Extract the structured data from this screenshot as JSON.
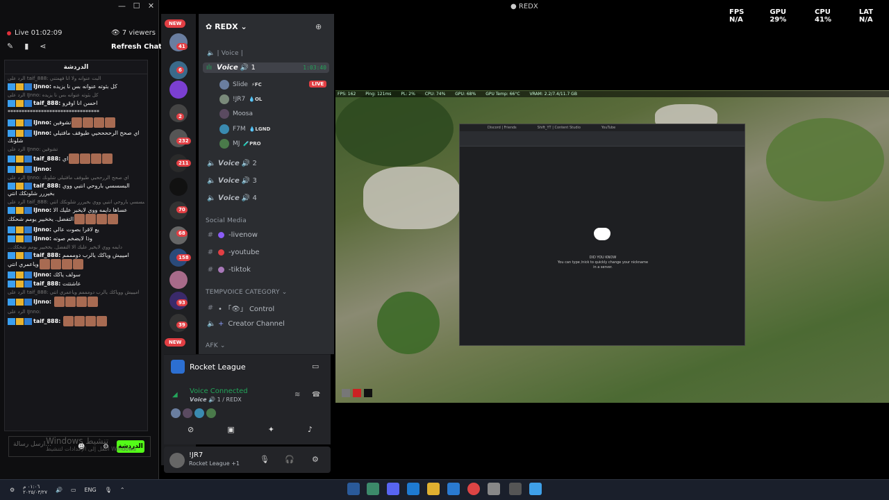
{
  "chat": {
    "live_time": "Live 01:02:09",
    "viewers": "7 viewers",
    "refresh": "Refresh Chat",
    "header": "الدردشة",
    "messages": [
      {
        "reply": "الرد على taif_888: البت عنوانه ولا انا فهمتني",
        "user": "IJnno:",
        "text": "كل بثوته عنوانه بس نا يزيده"
      },
      {
        "reply": "الرد على IJnno: كل بثوته عنوانه بس نا يزيده",
        "user": "taif_888:",
        "text": "احسن انا اوقرو"
      },
      {
        "reply": "",
        "user": "",
        "text": "*********************************"
      },
      {
        "reply": "",
        "user": "IJnno:",
        "text": "تشوفين"
      },
      {
        "reply": "",
        "user": "IJnno:",
        "text": "اي صحح الرححححيي طيوفف مافتيلي شلونك"
      },
      {
        "reply": "الرد على IJnno: تشوفين",
        "user": "taif_888:",
        "text": "اي"
      },
      {
        "reply": "",
        "user": "IJnno:",
        "text": ""
      },
      {
        "reply": "الرد على IJnno: اي صحح الررححيي طيوفف مافتيلي شلونك",
        "user": "taif_888:",
        "text": "البسسسي باروحي انتيي ووي بخيررر شلونكك انتي"
      },
      {
        "reply": "الرد على taif_888: البسسسي باروحي انتيي ووي بخيررر شلونكك انتي",
        "user": "IJnno:",
        "text": "عساها دايمه ووي لايخبر عليك الا التفضل. يخخيير يومم شحكك"
      },
      {
        "reply": "",
        "user": "IJnno:",
        "text": "يع لاقرا بصوت عالي"
      },
      {
        "reply": "",
        "user": "IJnno:",
        "text": "وذا لايضخم صوته"
      },
      {
        "reply": "...دايمه ووي لايخير عليك الا التفضل. يخخيير يومم شحكك",
        "user": "taif_888:",
        "text": "اميييش وياكك يالرب دومممم وياعمري انتي"
      },
      {
        "reply": "",
        "user": "IJnno:",
        "text": "سولف ياكك"
      },
      {
        "reply": "",
        "user": "taif_888:",
        "text": "عاشتتت"
      },
      {
        "reply": "الرد على taif_888: اميييش ووياكك يالرب دومممم وياعمري انتي",
        "user": "IJnno:",
        "text": ""
      },
      {
        "reply": "الرد على IJnno:",
        "user": "taif_888:",
        "text": ""
      }
    ],
    "input_placeholder": "ارسل رسالة...",
    "send": "الدردشة",
    "watermark1": "Windows تنشيط",
    "watermark2": "انتقل إلى الإعدادات لتنشيط Windows"
  },
  "discord": {
    "server_name": "REDX",
    "new_label": "NEW",
    "server_badges": [
      "41",
      "6",
      "2",
      "232",
      "211",
      "70",
      "68",
      "158",
      "93",
      "39"
    ],
    "categories": {
      "voices": "| Voice |",
      "social": "Social Media",
      "temp": "TEMPVOICE CATEGORY",
      "afk": "AFK"
    },
    "active_channel": "𝙑𝙤𝙞𝙘𝙚 🔊 1",
    "active_time": "1:03:40",
    "members": [
      {
        "name": "Slide",
        "tag": "⚡FC"
      },
      {
        "name": "!JR7",
        "tag": "💧OL"
      },
      {
        "name": "Moosa",
        "tag": ""
      },
      {
        "name": "F7M",
        "tag": "💧LGND"
      },
      {
        "name": "MJ",
        "tag": "🧪PRO"
      }
    ],
    "live": "LIVE",
    "voice_channels": [
      "𝙑𝙤𝙞𝙘𝙚 🔊 2",
      "𝙑𝙤𝙞𝙘𝙚 🔊 3",
      "𝙑𝙤𝙞𝙘𝙚 🔊 4"
    ],
    "social_channels": [
      "-livenow",
      "-youtube",
      "-tiktok"
    ],
    "temp_channels": [
      "• 「👁」 Control",
      "Creator Channel"
    ],
    "activity": "Rocket League",
    "voice_connected": "Voice Connected",
    "voice_sub": "𝙑𝙤𝙞𝙘𝙚 🔊 1 / REDX",
    "user_name": "!JR7",
    "user_status": "Rocket League +1"
  },
  "game": {
    "title": "REDX",
    "fps_label": "FPS",
    "fps": "N/A",
    "gpu_label": "GPU",
    "gpu": "29%",
    "cpu_label": "CPU",
    "cpu": "41%",
    "lat_label": "LAT",
    "lat": "N/A",
    "hud": [
      "FPS: 162",
      "Ping: 121ms",
      "PL: 2%",
      "CPU: 74%",
      "GPU: 68%",
      "GPU Temp: 66°C",
      "VRAM: 2.2/7.4/11.7 GB"
    ],
    "browser_tabs": [
      "Discord | Friends",
      "Shift_YT | Content Studio",
      "YouTube"
    ],
    "tip_title": "DID YOU KNOW",
    "tip_text": "You can type /nick to quickly change your nickname in a server."
  },
  "taskbar": {
    "time": "٠١:٠٦ م",
    "date": "٢٠٢٥/٠٣/٢٧",
    "lang": "ENG"
  }
}
